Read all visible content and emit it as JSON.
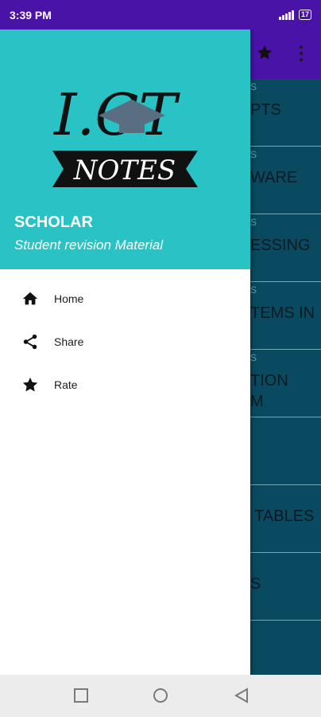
{
  "status_bar": {
    "time": "3:39 PM",
    "battery": "17"
  },
  "background_list": {
    "rows": [
      {
        "small": "S",
        "big": "PTS"
      },
      {
        "small": "S",
        "big": "WARE"
      },
      {
        "small": "S",
        "big": "ESSING"
      },
      {
        "small": "S",
        "big": "TEMS IN"
      },
      {
        "small": "S",
        "big": "TION\nM"
      },
      {
        "small": "",
        "big": ""
      },
      {
        "small": "",
        "big": " TABLES"
      },
      {
        "small": "",
        "big": "S"
      }
    ]
  },
  "drawer": {
    "logo": {
      "text_top": "I.CT",
      "text_banner": "NOTES"
    },
    "app_name": "SCHOLAR",
    "app_subtitle": "Student revision Material",
    "menu": [
      {
        "icon": "home-icon",
        "label": "Home"
      },
      {
        "icon": "share-icon",
        "label": "Share"
      },
      {
        "icon": "star-icon",
        "label": "Rate"
      }
    ]
  },
  "colors": {
    "status_bar": "#4a13a8",
    "drawer_header": "#29c3c5",
    "background_list": "#0a4a60"
  }
}
